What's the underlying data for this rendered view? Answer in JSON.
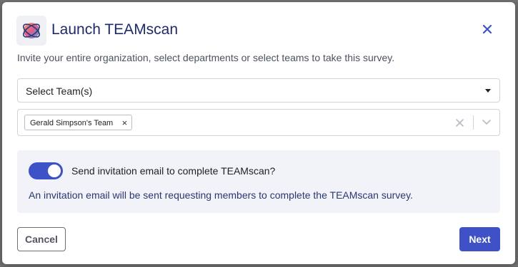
{
  "modal": {
    "title": "Launch TEAMscan",
    "subtitle": "Invite your entire organization, select departments or select teams to take this survey.",
    "logo_icon": "teamscan-logo-icon",
    "close_icon": "close-icon"
  },
  "team_select": {
    "value": "Select Team(s)",
    "selected_chips": [
      {
        "label": "Gerald Simpson's Team"
      }
    ],
    "chip_remove_icon": "×"
  },
  "invitation": {
    "toggle_on": true,
    "toggle_label": "Send invitation email to complete TEAMscan?",
    "note": "An invitation email will be sent requesting members to complete the TEAMscan survey."
  },
  "footer": {
    "cancel_label": "Cancel",
    "next_label": "Next"
  },
  "colors": {
    "primary": "#3f51c7",
    "title": "#1f2a6b",
    "panel_bg": "#f1f3f9"
  }
}
